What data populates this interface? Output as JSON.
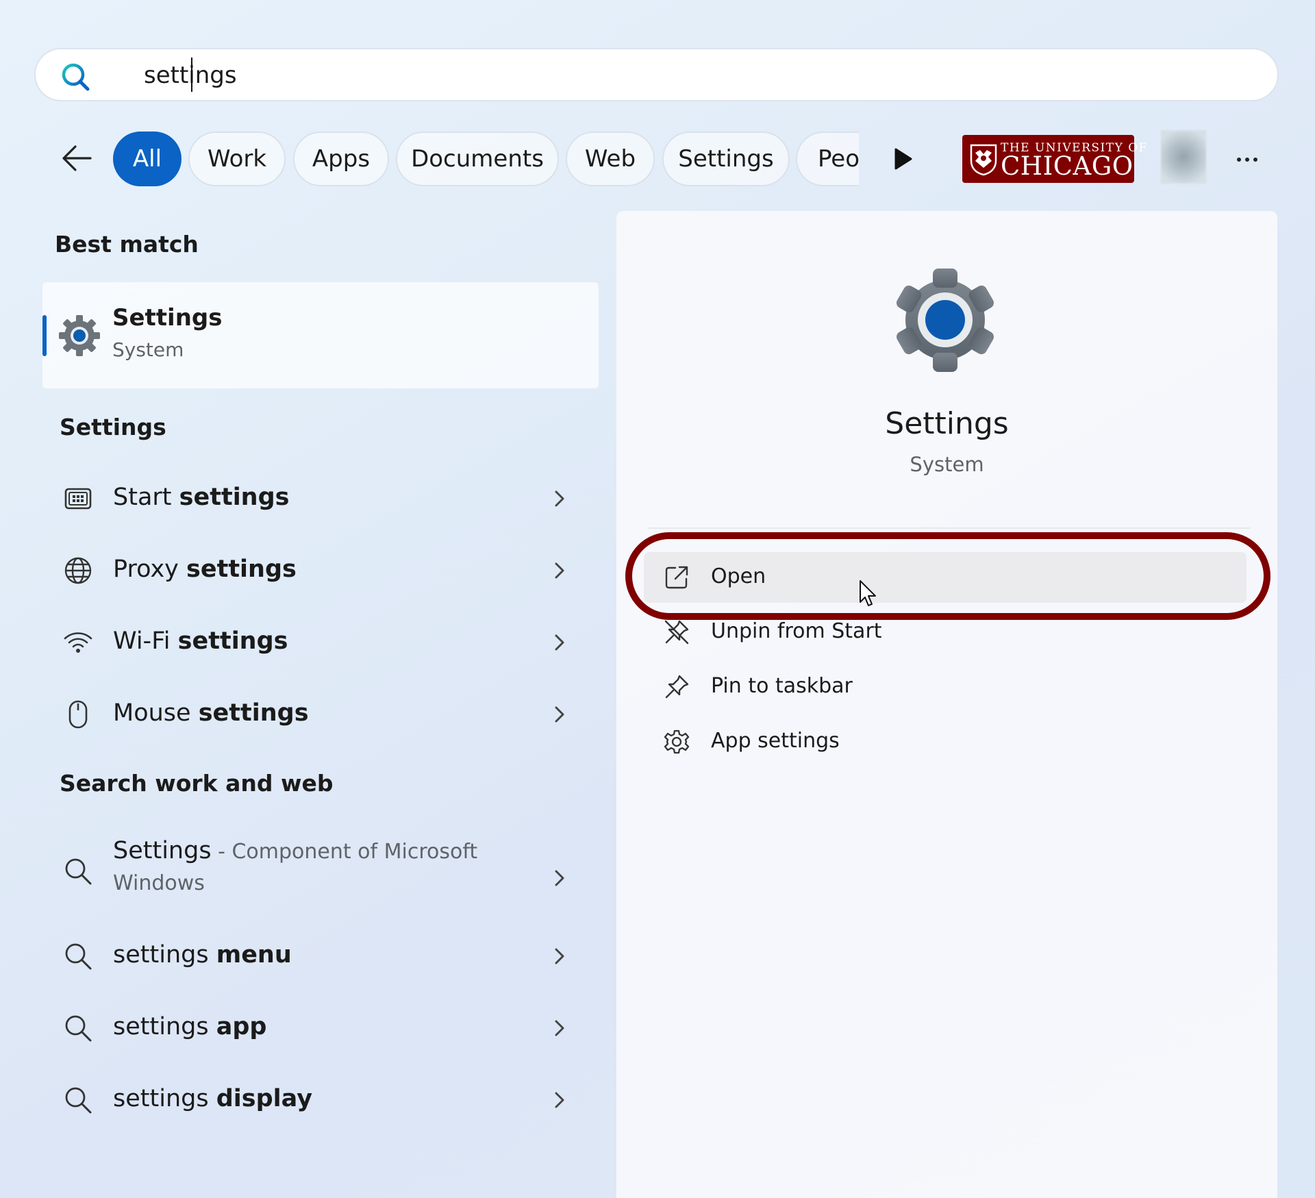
{
  "search": {
    "value": "settings",
    "placeholder": ""
  },
  "filters": {
    "chips": [
      "All",
      "Work",
      "Apps",
      "Documents",
      "Web",
      "Settings",
      "Peo"
    ],
    "active": "All"
  },
  "logo": {
    "line1": "THE UNIVERSITY OF",
    "line2": "CHICAGO"
  },
  "left": {
    "best_match_heading": "Best match",
    "best_match": {
      "title": "Settings",
      "subtitle": "System"
    },
    "settings_heading": "Settings",
    "settings_items": [
      {
        "prefix": "Start",
        "bold": "settings",
        "icon": "start-icon"
      },
      {
        "prefix": "Proxy",
        "bold": "settings",
        "icon": "globe-icon"
      },
      {
        "prefix": "Wi-Fi",
        "bold": "settings",
        "icon": "wifi-icon"
      },
      {
        "prefix": "Mouse",
        "bold": "settings",
        "icon": "mouse-icon"
      }
    ],
    "web_heading": "Search work and web",
    "web_items": [
      {
        "main": "Settings",
        "desc": " - Component of Microsoft",
        "desc2": "Windows"
      },
      {
        "prefix": "settings",
        "bold": "menu"
      },
      {
        "prefix": "settings",
        "bold": "app"
      },
      {
        "prefix": "settings",
        "bold": "display"
      }
    ]
  },
  "detail": {
    "title": "Settings",
    "subtitle": "System",
    "actions": [
      "Open",
      "Unpin from Start",
      "Pin to taskbar",
      "App settings"
    ]
  },
  "colors": {
    "accent": "#0b63c5",
    "highlight": "#800000",
    "logo_bg": "#800000"
  }
}
